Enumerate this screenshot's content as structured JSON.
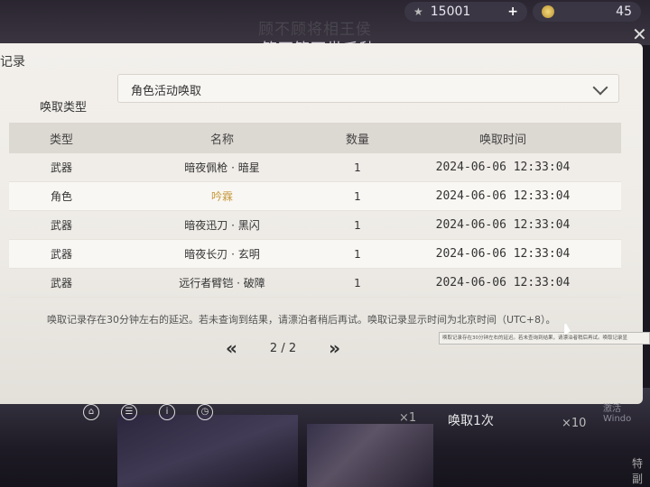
{
  "header": {
    "line1": "顾不顾将相王侯",
    "line2": "管不管万世千秋",
    "currency1": "15001",
    "currency2": "45"
  },
  "panel": {
    "title": "记录",
    "type_label": "唤取类型",
    "dropdown_value": "角色活动唤取"
  },
  "table": {
    "headers": [
      "类型",
      "名称",
      "数量",
      "唤取时间"
    ],
    "rows": [
      {
        "type": "武器",
        "name": "暗夜佩枪 · 暗星",
        "qty": "1",
        "time": "2024-06-06 12:33:04"
      },
      {
        "type": "角色",
        "name": "吟霖",
        "qty": "1",
        "time": "2024-06-06 12:33:04"
      },
      {
        "type": "武器",
        "name": "暗夜迅刀 · 黑闪",
        "qty": "1",
        "time": "2024-06-06 12:33:04"
      },
      {
        "type": "武器",
        "name": "暗夜长刃 · 玄明",
        "qty": "1",
        "time": "2024-06-06 12:33:04"
      },
      {
        "type": "武器",
        "name": "远行者臂铠 · 破障",
        "qty": "1",
        "time": "2024-06-06 12:33:04"
      }
    ]
  },
  "note": "唤取记录存在30分钟左右的延迟。若未查询到结果，请漂泊者稍后再试。唤取记录显示时间为北京时间（UTC+8）。",
  "tooltip": "唤取记录存在30分钟左右的延迟。若未查询到结果，请漂泊者稍后再试。唤取记录显",
  "pager": {
    "label": "2 / 2"
  },
  "footer": {
    "x1": "×1",
    "pull1": "唤取1次",
    "x10": "×10",
    "watermark": "激活 Windo",
    "special": "特副"
  },
  "colors": {
    "highlight": "#c79a3f"
  }
}
